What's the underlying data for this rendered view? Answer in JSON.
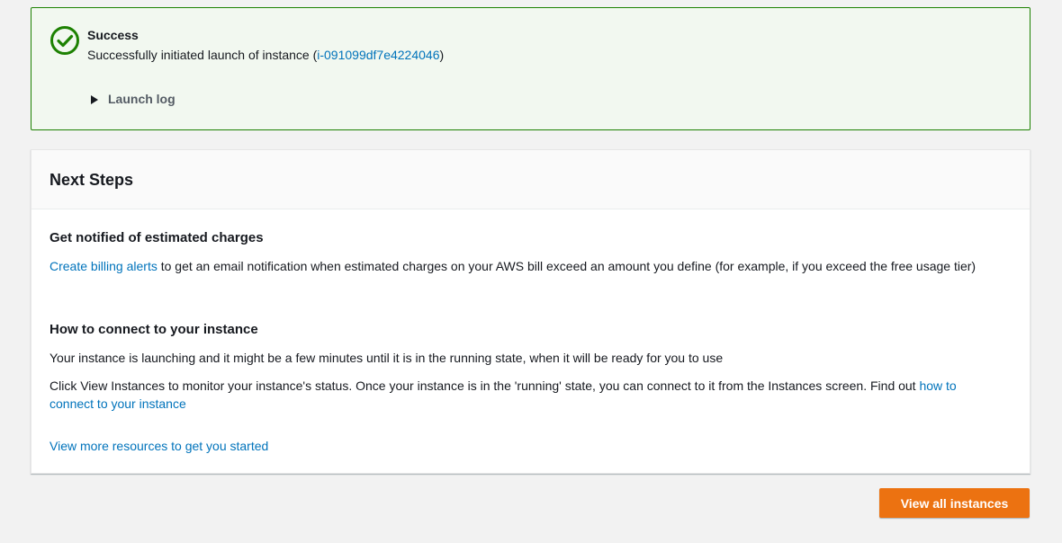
{
  "alert": {
    "title": "Success",
    "message_prefix": "Successfully initiated launch of instance (",
    "instance_id": "i-091099df7e4224046",
    "message_suffix": ")",
    "launch_log_label": "Launch log",
    "status_color": "#1d8102"
  },
  "next_steps": {
    "heading": "Next Steps",
    "billing": {
      "title": "Get notified of estimated charges",
      "link": "Create billing alerts",
      "text": " to get an email notification when estimated charges on your AWS bill exceed an amount you define (for example, if you exceed the free usage tier)"
    },
    "connect": {
      "title": "How to connect to your instance",
      "para1": "Your instance is launching and it might be a few minutes until it is in the running state, when it will be ready for you to use",
      "para2_text": "Click View Instances to monitor your instance's status. Once your instance is in the 'running' state, you can connect to it from the Instances screen. Find out ",
      "para2_link": "how to connect to your instance"
    },
    "more_resources_link": "View more resources to get you started"
  },
  "actions": {
    "view_all_label": "View all instances",
    "primary_color": "#ec7211"
  },
  "link_color": "#0073bb"
}
